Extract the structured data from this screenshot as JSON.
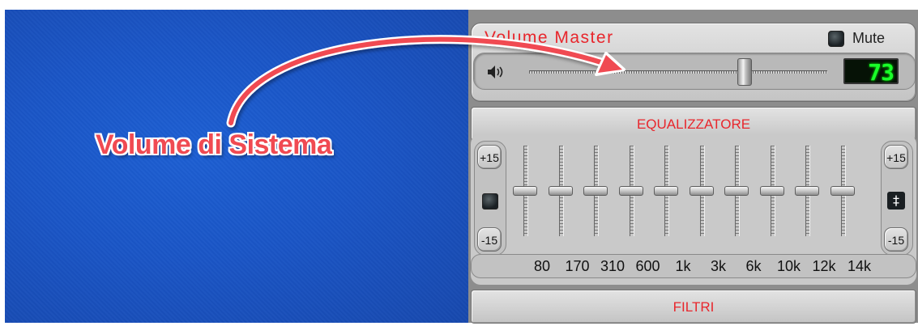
{
  "annotation": {
    "caption": "Volume di Sistema"
  },
  "master": {
    "title": "Volume Master",
    "mute_label": "Mute",
    "volume_display": "73",
    "volume_level": 0.72
  },
  "sections": {
    "equalizer_label": "EQUALIZZATORE",
    "filters_label": "FILTRI"
  },
  "eq": {
    "max_label": "+15",
    "min_label": "-15",
    "bands": [
      {
        "freq": "80",
        "level": 0
      },
      {
        "freq": "170",
        "level": 0
      },
      {
        "freq": "310",
        "level": 0
      },
      {
        "freq": "600",
        "level": 0
      },
      {
        "freq": "1k",
        "level": 0
      },
      {
        "freq": "3k",
        "level": 0
      },
      {
        "freq": "6k",
        "level": 0
      },
      {
        "freq": "10k",
        "level": 0
      },
      {
        "freq": "12k",
        "level": 0
      },
      {
        "freq": "14k",
        "level": 0
      }
    ]
  },
  "icons": {
    "speaker": "speaker-icon",
    "eq_toggle": "eq-toggle-icon",
    "eq_reset": "eq-reset-icon",
    "annotation_arrow": "curved-arrow-icon"
  },
  "colors": {
    "accent_red": "#e8262c",
    "desktop_blue": "#1a55c6",
    "lcd_green": "#1aff2a"
  }
}
